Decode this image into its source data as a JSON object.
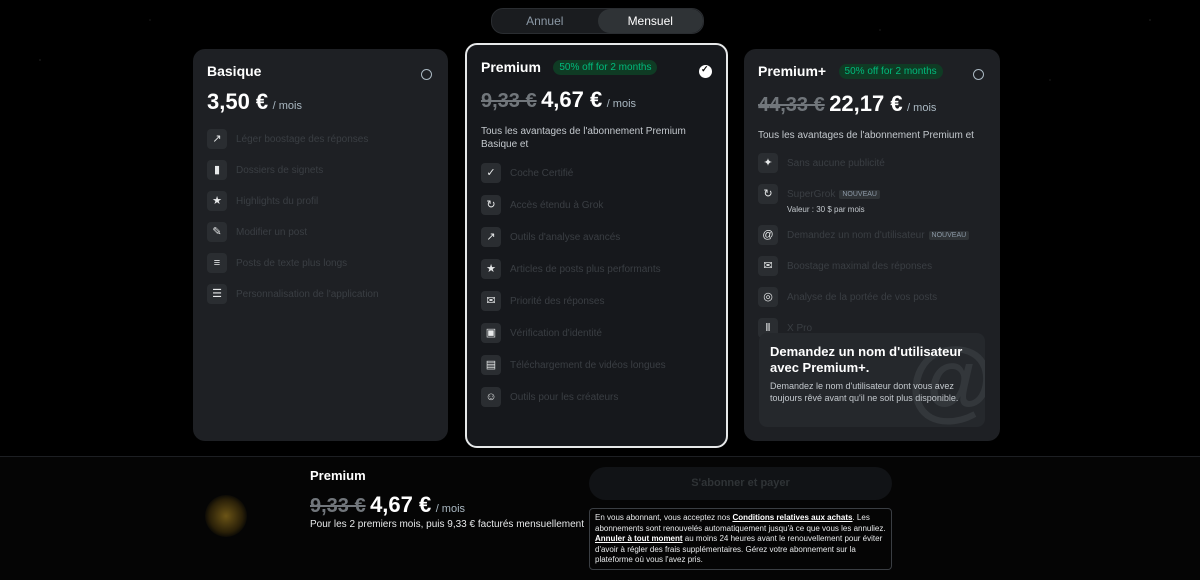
{
  "toggle": {
    "annual": "Annuel",
    "monthly": "Mensuel"
  },
  "basic": {
    "name": "Basique",
    "price": "3,50 €",
    "per": "/ mois",
    "features": [
      {
        "icon": "rocket-icon",
        "label": "Léger boostage des réponses"
      },
      {
        "icon": "bookmark-icon",
        "label": "Dossiers de signets"
      },
      {
        "icon": "star-icon",
        "label": "Highlights du profil"
      },
      {
        "icon": "edit-icon",
        "label": "Modifier un post"
      },
      {
        "icon": "text-icon",
        "label": "Posts de texte plus longs"
      },
      {
        "icon": "settings-icon",
        "label": "Personnalisation de l'application"
      }
    ]
  },
  "premium": {
    "name": "Premium",
    "offer": "50% off for 2 months",
    "old_price": "9,33 €",
    "price": "4,67 €",
    "per": "/ mois",
    "desc": "Tous les avantages de l'abonnement Premium Basique et",
    "features": [
      {
        "icon": "verified-icon",
        "label": "Coche Certifié"
      },
      {
        "icon": "grok-icon",
        "label": "Accès étendu à Grok"
      },
      {
        "icon": "analytics-icon",
        "label": "Outils d'analyse avancés"
      },
      {
        "icon": "star-icon",
        "label": "Articles de posts plus performants"
      },
      {
        "icon": "reply-icon",
        "label": "Priorité des réponses"
      },
      {
        "icon": "id-icon",
        "label": "Vérification d'identité"
      },
      {
        "icon": "media-icon",
        "label": "Téléchargement de vidéos longues"
      },
      {
        "icon": "creator-icon",
        "label": "Outils pour les créateurs"
      }
    ]
  },
  "plus": {
    "name": "Premium+",
    "offer": "50% off for 2 months",
    "old_price": "44,33 €",
    "price": "22,17 €",
    "per": "/ mois",
    "desc": "Tous les avantages de l'abonnement Premium et",
    "features": [
      {
        "icon": "sparkle-icon",
        "label": "Sans aucune publicité"
      },
      {
        "icon": "grok-icon",
        "label": "SuperGrok",
        "badge": "NOUVEAU",
        "sub": "Valeur : 30 $ par mois"
      },
      {
        "icon": "at-icon",
        "label": "Demandez un nom d'utilisateur",
        "badge": "NOUVEAU"
      },
      {
        "icon": "reply-icon",
        "label": "Boostage maximal des réponses"
      },
      {
        "icon": "target-icon",
        "label": "Analyse de la portée de vos posts"
      },
      {
        "icon": "columns-icon",
        "label": "X Pro"
      }
    ],
    "promo": {
      "title": "Demandez un nom d'utilisateur avec Premium+.",
      "desc": "Demandez le nom d'utilisateur dont vous avez toujours rêvé avant qu'il ne soit plus disponible."
    }
  },
  "footer": {
    "plan": "Premium",
    "old_price": "9,33 €",
    "price": "4,67 €",
    "per": "/ mois",
    "note": "Pour les 2 premiers mois, puis 9,33 € facturés mensuellement",
    "button": "S'abonner et payer",
    "terms_1": "En vous abonnant, vous acceptez nos ",
    "terms_link1": "Conditions relatives aux achats",
    "terms_2": ". Les abonnements sont renouvelés automatiquement jusqu'à ce que vous les annuliez. ",
    "terms_link2": "Annuler à tout moment",
    "terms_3": " au moins 24 heures avant le renouvellement pour éviter d'avoir à régler des frais supplémentaires. Gérez votre abonnement sur la plateforme où vous l'avez pris."
  }
}
